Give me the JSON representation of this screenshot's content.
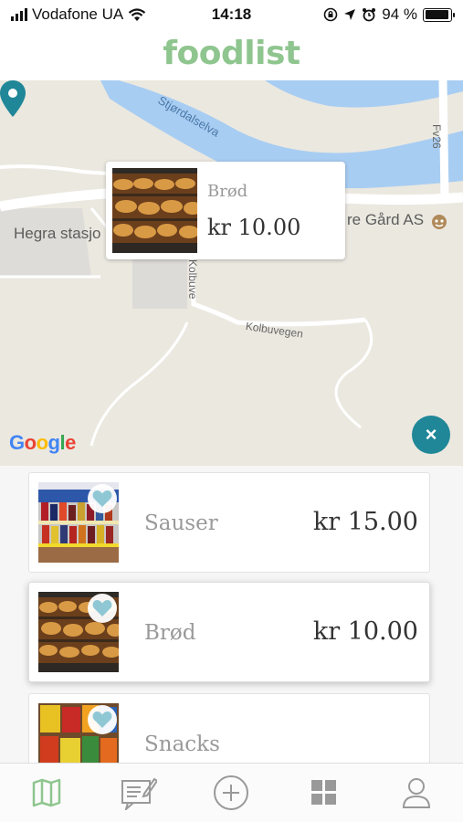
{
  "status_bar": {
    "carrier": "Vodafone UA",
    "time": "14:18",
    "battery": "94 %",
    "battery_level": 0.94,
    "icons": [
      "signal-icon",
      "wifi-icon",
      "rotation-lock-icon",
      "location-icon",
      "alarm-icon",
      "battery-icon"
    ]
  },
  "header": {
    "title": "foodlist",
    "title_color": "#8fc58f"
  },
  "map": {
    "labels": {
      "river": "Stjørdalselva",
      "road_fv": "Fv26",
      "station": "Hegra stasjo",
      "place": "re Gård AS",
      "street1": "Kolbuve",
      "street2": "Kolbuvegen"
    },
    "provider": "Google",
    "popup": {
      "name": "Brød",
      "price": "kr 10.00"
    },
    "pin_color": "#1f8798",
    "close_button": "×"
  },
  "products": [
    {
      "name": "Sauser",
      "price": "kr 15.00",
      "image": "sauces-shelf"
    },
    {
      "name": "Brød",
      "price": "kr 10.00",
      "image": "bread-shelf"
    },
    {
      "name": "Snacks",
      "price": "",
      "image": "snacks-shelf"
    }
  ],
  "tabs": [
    {
      "icon": "map-icon",
      "active": true
    },
    {
      "icon": "edit-list-icon",
      "active": false
    },
    {
      "icon": "add-circle-icon",
      "active": false
    },
    {
      "icon": "grid-icon",
      "active": false
    },
    {
      "icon": "profile-icon",
      "active": false
    }
  ],
  "colors": {
    "accent": "#1f8798",
    "active_tab": "#8fc58f",
    "heart": "#8fc8d4"
  }
}
